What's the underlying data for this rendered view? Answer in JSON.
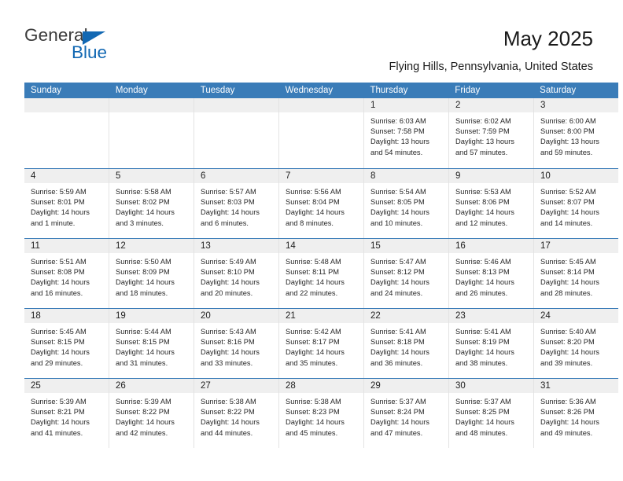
{
  "brand": {
    "name_top": "General",
    "name_bottom": "Blue",
    "triangle_icon": "blue-triangle-icon",
    "color_text": "#3b3b3b",
    "color_blue": "#1268b3"
  },
  "header": {
    "title": "May 2025",
    "subtitle": "Flying Hills, Pennsylvania, United States"
  },
  "theme": {
    "header_blue": "#3a7cb8",
    "daynum_band": "#efefef",
    "cell_border": "#e3e3e3",
    "text": "#262626"
  },
  "calendar": {
    "weekday_headers": [
      "Sunday",
      "Monday",
      "Tuesday",
      "Wednesday",
      "Thursday",
      "Friday",
      "Saturday"
    ],
    "weeks": [
      [
        {
          "day": "",
          "empty": true
        },
        {
          "day": "",
          "empty": true
        },
        {
          "day": "",
          "empty": true
        },
        {
          "day": "",
          "empty": true
        },
        {
          "day": "1",
          "sunrise": "Sunrise: 6:03 AM",
          "sunset": "Sunset: 7:58 PM",
          "daylight": "Daylight: 13 hours and 54 minutes."
        },
        {
          "day": "2",
          "sunrise": "Sunrise: 6:02 AM",
          "sunset": "Sunset: 7:59 PM",
          "daylight": "Daylight: 13 hours and 57 minutes."
        },
        {
          "day": "3",
          "sunrise": "Sunrise: 6:00 AM",
          "sunset": "Sunset: 8:00 PM",
          "daylight": "Daylight: 13 hours and 59 minutes."
        }
      ],
      [
        {
          "day": "4",
          "sunrise": "Sunrise: 5:59 AM",
          "sunset": "Sunset: 8:01 PM",
          "daylight": "Daylight: 14 hours and 1 minute."
        },
        {
          "day": "5",
          "sunrise": "Sunrise: 5:58 AM",
          "sunset": "Sunset: 8:02 PM",
          "daylight": "Daylight: 14 hours and 3 minutes."
        },
        {
          "day": "6",
          "sunrise": "Sunrise: 5:57 AM",
          "sunset": "Sunset: 8:03 PM",
          "daylight": "Daylight: 14 hours and 6 minutes."
        },
        {
          "day": "7",
          "sunrise": "Sunrise: 5:56 AM",
          "sunset": "Sunset: 8:04 PM",
          "daylight": "Daylight: 14 hours and 8 minutes."
        },
        {
          "day": "8",
          "sunrise": "Sunrise: 5:54 AM",
          "sunset": "Sunset: 8:05 PM",
          "daylight": "Daylight: 14 hours and 10 minutes."
        },
        {
          "day": "9",
          "sunrise": "Sunrise: 5:53 AM",
          "sunset": "Sunset: 8:06 PM",
          "daylight": "Daylight: 14 hours and 12 minutes."
        },
        {
          "day": "10",
          "sunrise": "Sunrise: 5:52 AM",
          "sunset": "Sunset: 8:07 PM",
          "daylight": "Daylight: 14 hours and 14 minutes."
        }
      ],
      [
        {
          "day": "11",
          "sunrise": "Sunrise: 5:51 AM",
          "sunset": "Sunset: 8:08 PM",
          "daylight": "Daylight: 14 hours and 16 minutes."
        },
        {
          "day": "12",
          "sunrise": "Sunrise: 5:50 AM",
          "sunset": "Sunset: 8:09 PM",
          "daylight": "Daylight: 14 hours and 18 minutes."
        },
        {
          "day": "13",
          "sunrise": "Sunrise: 5:49 AM",
          "sunset": "Sunset: 8:10 PM",
          "daylight": "Daylight: 14 hours and 20 minutes."
        },
        {
          "day": "14",
          "sunrise": "Sunrise: 5:48 AM",
          "sunset": "Sunset: 8:11 PM",
          "daylight": "Daylight: 14 hours and 22 minutes."
        },
        {
          "day": "15",
          "sunrise": "Sunrise: 5:47 AM",
          "sunset": "Sunset: 8:12 PM",
          "daylight": "Daylight: 14 hours and 24 minutes."
        },
        {
          "day": "16",
          "sunrise": "Sunrise: 5:46 AM",
          "sunset": "Sunset: 8:13 PM",
          "daylight": "Daylight: 14 hours and 26 minutes."
        },
        {
          "day": "17",
          "sunrise": "Sunrise: 5:45 AM",
          "sunset": "Sunset: 8:14 PM",
          "daylight": "Daylight: 14 hours and 28 minutes."
        }
      ],
      [
        {
          "day": "18",
          "sunrise": "Sunrise: 5:45 AM",
          "sunset": "Sunset: 8:15 PM",
          "daylight": "Daylight: 14 hours and 29 minutes."
        },
        {
          "day": "19",
          "sunrise": "Sunrise: 5:44 AM",
          "sunset": "Sunset: 8:15 PM",
          "daylight": "Daylight: 14 hours and 31 minutes."
        },
        {
          "day": "20",
          "sunrise": "Sunrise: 5:43 AM",
          "sunset": "Sunset: 8:16 PM",
          "daylight": "Daylight: 14 hours and 33 minutes."
        },
        {
          "day": "21",
          "sunrise": "Sunrise: 5:42 AM",
          "sunset": "Sunset: 8:17 PM",
          "daylight": "Daylight: 14 hours and 35 minutes."
        },
        {
          "day": "22",
          "sunrise": "Sunrise: 5:41 AM",
          "sunset": "Sunset: 8:18 PM",
          "daylight": "Daylight: 14 hours and 36 minutes."
        },
        {
          "day": "23",
          "sunrise": "Sunrise: 5:41 AM",
          "sunset": "Sunset: 8:19 PM",
          "daylight": "Daylight: 14 hours and 38 minutes."
        },
        {
          "day": "24",
          "sunrise": "Sunrise: 5:40 AM",
          "sunset": "Sunset: 8:20 PM",
          "daylight": "Daylight: 14 hours and 39 minutes."
        }
      ],
      [
        {
          "day": "25",
          "sunrise": "Sunrise: 5:39 AM",
          "sunset": "Sunset: 8:21 PM",
          "daylight": "Daylight: 14 hours and 41 minutes."
        },
        {
          "day": "26",
          "sunrise": "Sunrise: 5:39 AM",
          "sunset": "Sunset: 8:22 PM",
          "daylight": "Daylight: 14 hours and 42 minutes."
        },
        {
          "day": "27",
          "sunrise": "Sunrise: 5:38 AM",
          "sunset": "Sunset: 8:22 PM",
          "daylight": "Daylight: 14 hours and 44 minutes."
        },
        {
          "day": "28",
          "sunrise": "Sunrise: 5:38 AM",
          "sunset": "Sunset: 8:23 PM",
          "daylight": "Daylight: 14 hours and 45 minutes."
        },
        {
          "day": "29",
          "sunrise": "Sunrise: 5:37 AM",
          "sunset": "Sunset: 8:24 PM",
          "daylight": "Daylight: 14 hours and 47 minutes."
        },
        {
          "day": "30",
          "sunrise": "Sunrise: 5:37 AM",
          "sunset": "Sunset: 8:25 PM",
          "daylight": "Daylight: 14 hours and 48 minutes."
        },
        {
          "day": "31",
          "sunrise": "Sunrise: 5:36 AM",
          "sunset": "Sunset: 8:26 PM",
          "daylight": "Daylight: 14 hours and 49 minutes."
        }
      ]
    ]
  }
}
